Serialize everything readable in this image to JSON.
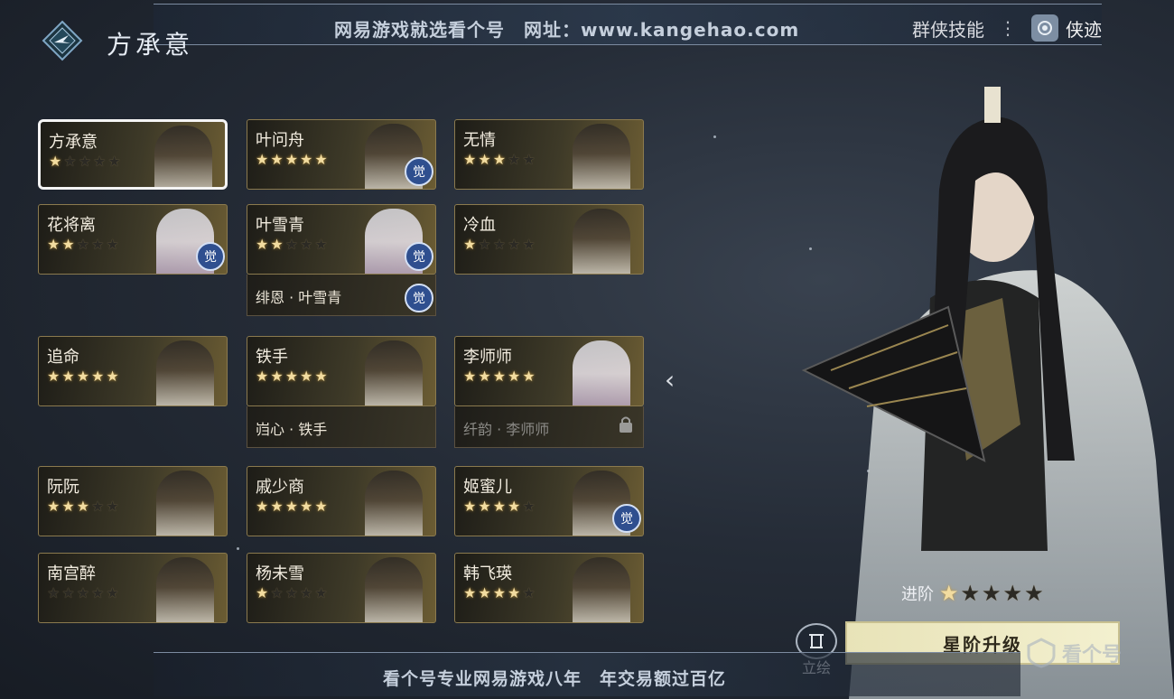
{
  "header": {
    "title": "方承意",
    "watermark_banner": "网易游戏就选看个号　网址：www.kangehao.com",
    "nav_skill": "群侠技能",
    "nav_dots": "⋮",
    "nav_trace": "侠迹"
  },
  "heroes": [
    {
      "name": "方承意",
      "stars": 1,
      "awakened": false,
      "selected": true
    },
    {
      "name": "叶问舟",
      "stars": 5,
      "awakened": true,
      "selected": false
    },
    {
      "name": "无情",
      "stars": 3,
      "awakened": false,
      "selected": false
    },
    {
      "name": "花将离",
      "stars": 2,
      "awakened": true,
      "selected": false
    },
    {
      "name": "叶雪青",
      "stars": 2,
      "awakened": true,
      "selected": false,
      "variant": {
        "name": "绯恩 · 叶雪青",
        "awakened": true,
        "locked": false
      }
    },
    {
      "name": "冷血",
      "stars": 1,
      "awakened": false,
      "selected": false
    },
    {
      "name": "追命",
      "stars": 5,
      "awakened": false,
      "selected": false
    },
    {
      "name": "铁手",
      "stars": 5,
      "awakened": false,
      "selected": false,
      "variant": {
        "name": "岿心 · 铁手",
        "awakened": false,
        "locked": false
      }
    },
    {
      "name": "李师师",
      "stars": 5,
      "awakened": false,
      "selected": false,
      "variant": {
        "name": "纤韵 · 李师师",
        "awakened": false,
        "locked": true
      }
    },
    {
      "name": "阮阮",
      "stars": 3,
      "awakened": false,
      "selected": false
    },
    {
      "name": "戚少商",
      "stars": 5,
      "awakened": false,
      "selected": false
    },
    {
      "name": "姬蜜儿",
      "stars": 4,
      "awakened": true,
      "selected": false
    },
    {
      "name": "南宫醉",
      "stars": 0,
      "awakened": false,
      "selected": false
    },
    {
      "name": "杨未雪",
      "stars": 1,
      "awakened": false,
      "selected": false
    },
    {
      "name": "韩飞瑛",
      "stars": 4,
      "awakened": false,
      "selected": false
    }
  ],
  "awaken_badge": "觉",
  "advancement": {
    "label": "进阶",
    "stars": 1,
    "max_stars": 5
  },
  "upgrade_button": "星阶升级",
  "portrait_button": "立绘",
  "bottom_banner": "看个号专业网易游戏八年　年交易额过百亿",
  "watermark_logo": "看个号",
  "colors": {
    "star_on": "#f2dca0",
    "card_border": "#8b7a4e",
    "selected_border": "#f4f4f4",
    "awake_badge": "#2f4f8f"
  }
}
